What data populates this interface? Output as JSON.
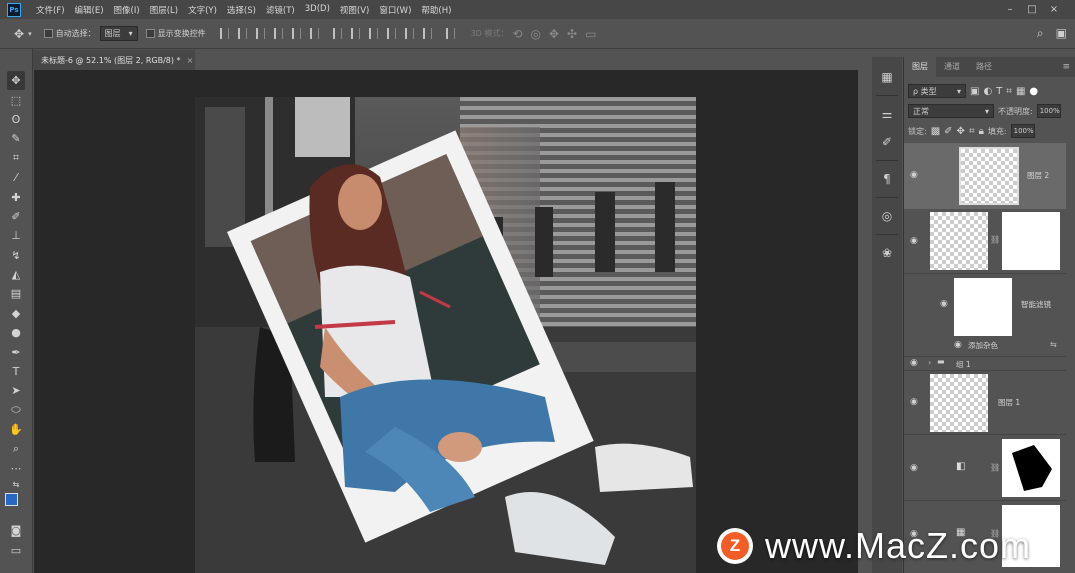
{
  "app": {
    "logo_text": "Ps"
  },
  "menu": [
    "文件(F)",
    "编辑(E)",
    "图像(I)",
    "图层(L)",
    "文字(Y)",
    "选择(S)",
    "滤镜(T)",
    "3D(D)",
    "视图(V)",
    "窗口(W)",
    "帮助(H)"
  ],
  "window_controls": {
    "minimize": "–",
    "maximize": "□",
    "close": "×"
  },
  "options_bar": {
    "auto_select_label": "自动选择：",
    "auto_select_value": "图层",
    "show_transform_label": "显示变换控件",
    "mode_label": "3D 模式："
  },
  "document": {
    "tab_label": "未标题-6 @ 52.1% (图层 2, RGB/8) *",
    "close": "×"
  },
  "layers_panel": {
    "tabs": [
      "图层",
      "通道",
      "路径"
    ],
    "filter_kind": "ρ 类型",
    "blend_mode": "正常",
    "opacity_label": "不透明度:",
    "opacity_value": "100%",
    "lock_label": "锁定:",
    "fill_label": "填充:",
    "fill_value": "100%",
    "layers": [
      {
        "name": "图层 2"
      },
      {
        "name": ""
      },
      {
        "name": "智能滤镜"
      },
      {
        "name": "添加杂色"
      },
      {
        "name": "组 1"
      },
      {
        "name": "图层 1"
      },
      {
        "name": ""
      },
      {
        "name": ""
      }
    ]
  },
  "watermark": {
    "logo": "Z",
    "text": "www.MacZ.com"
  },
  "colors": {
    "foreground": "#2a67c5",
    "background": "#2a67c5",
    "accent": "#f25c27"
  }
}
